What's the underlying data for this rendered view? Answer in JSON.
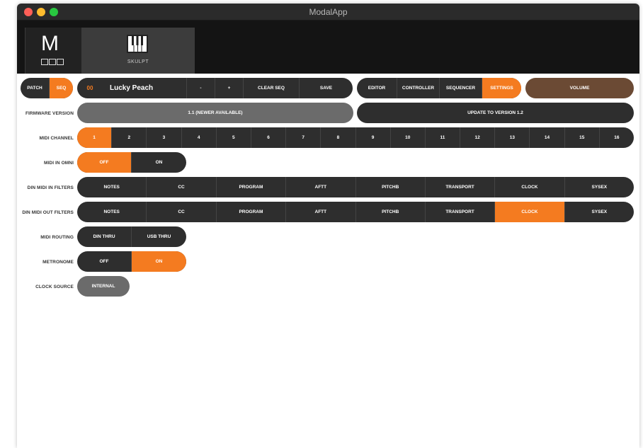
{
  "window": {
    "title": "ModalApp"
  },
  "header": {
    "device_label": "SKULPT",
    "logo_letter": "M"
  },
  "patchbar": {
    "patch": "PATCH",
    "seq": "SEQ",
    "number": "00",
    "name": "Lucky Peach",
    "minus": "-",
    "plus": "+",
    "clear_seq": "CLEAR SEQ",
    "save": "SAVE"
  },
  "modes": [
    "EDITOR",
    "CONTROLLER",
    "SEQUENCER",
    "SETTINGS"
  ],
  "volume": "VOLUME",
  "firmware": {
    "label": "FIRMWARE VERSION",
    "current": "1.1 (NEWER AVAILABLE)",
    "update": "UPDATE TO VERSION 1.2"
  },
  "midi_channel": {
    "label": "MIDI CHANNEL",
    "values": [
      "1",
      "2",
      "3",
      "4",
      "5",
      "6",
      "7",
      "8",
      "9",
      "10",
      "11",
      "12",
      "13",
      "14",
      "15",
      "16"
    ],
    "selected": "1"
  },
  "midi_omni": {
    "label": "MIDI IN OMNI",
    "off": "OFF",
    "on": "ON",
    "selected": "OFF"
  },
  "din_in_filters": {
    "label": "DIN MIDI IN FILTERS",
    "items": [
      "NOTES",
      "CC",
      "PROGRAM",
      "AFTT",
      "PITCHB",
      "TRANSPORT",
      "CLOCK",
      "SYSEX"
    ]
  },
  "din_out_filters": {
    "label": "DIN MIDI OUT FILTERS",
    "items": [
      "NOTES",
      "CC",
      "PROGRAM",
      "AFTT",
      "PITCHB",
      "TRANSPORT",
      "CLOCK",
      "SYSEX"
    ],
    "selected": "CLOCK"
  },
  "midi_routing": {
    "label": "MIDI ROUTING",
    "din": "DIN THRU",
    "usb": "USB THRU"
  },
  "metronome": {
    "label": "METRONOME",
    "off": "OFF",
    "on": "ON",
    "selected": "ON"
  },
  "clock_source": {
    "label": "CLOCK SOURCE",
    "value": "INTERNAL"
  },
  "colors": {
    "accent": "#f47b20",
    "dark": "#2e2e2e",
    "volume": "#6b4a34"
  }
}
